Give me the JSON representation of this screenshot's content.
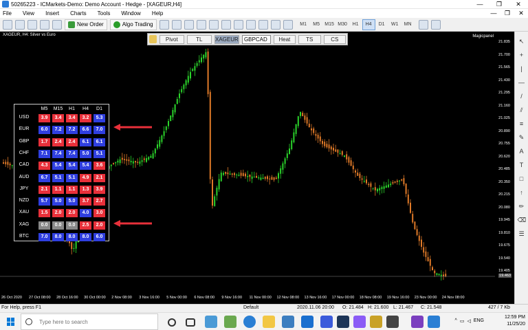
{
  "window": {
    "title": "50265223 - ICMarkets-Demo: Demo Account - Hedge - [XAGEUR,H4]",
    "controls": [
      "—",
      "❐",
      "✕"
    ]
  },
  "menu": {
    "items": [
      "File",
      "View",
      "Insert",
      "Charts",
      "Tools",
      "Window",
      "Help"
    ],
    "mdi_controls": [
      "—",
      "❐",
      "✕"
    ]
  },
  "toolbar": {
    "new_order_label": "New Order",
    "algo_trading_label": "Algo Trading",
    "timeframes": [
      "M1",
      "M5",
      "M15",
      "M30",
      "H1",
      "H4",
      "D1",
      "W1",
      "MN"
    ],
    "active_timeframe": "H4"
  },
  "chart": {
    "label": "XAGEUR, H4: Silver vs Euro",
    "panel_label": "Magicpanel",
    "buttons": [
      "Pivot",
      "TL",
      "XAGEUR",
      "Heat",
      "TS",
      "CS"
    ],
    "selected_button": "XAGEUR",
    "symbol_dropdown": "GBPCAD",
    "price_axis": [
      "21.835",
      "21.700",
      "21.565",
      "21.430",
      "21.295",
      "21.160",
      "21.025",
      "20.890",
      "20.755",
      "20.620",
      "20.485",
      "20.350",
      "20.215",
      "20.080",
      "19.945",
      "19.810",
      "19.675",
      "19.540",
      "19.405"
    ],
    "current_price": "19.463",
    "time_axis": [
      "26 Oct 2020",
      "27 Oct 08:00",
      "28 Oct 16:00",
      "30 Oct 00:00",
      "2 Nov 08:00",
      "3 Nov 16:00",
      "5 Nov 00:00",
      "6 Nov 08:00",
      "9 Nov 16:00",
      "11 Nov 00:00",
      "12 Nov 08:00",
      "13 Nov 16:00",
      "17 Nov 00:00",
      "18 Nov 08:00",
      "19 Nov 16:00",
      "23 Nov 00:00",
      "24 Nov 08:00"
    ]
  },
  "matrix": {
    "columns": [
      "M5",
      "M15",
      "H1",
      "H4",
      "D1"
    ],
    "rows": [
      {
        "label": "USD",
        "values": [
          "3.9",
          "3.4",
          "3.4",
          "3.2",
          "5.3"
        ],
        "colors": [
          "r",
          "r",
          "r",
          "r",
          "b"
        ]
      },
      {
        "label": "EUR",
        "values": [
          "6.0",
          "7.2",
          "7.2",
          "6.6",
          "7.0"
        ],
        "colors": [
          "b",
          "b",
          "b",
          "b",
          "b"
        ]
      },
      {
        "label": "GBP",
        "values": [
          "1.7",
          "2.4",
          "2.4",
          "6.1",
          "6.1"
        ],
        "colors": [
          "r",
          "r",
          "r",
          "b",
          "b"
        ]
      },
      {
        "label": "CHF",
        "values": [
          "7.1",
          "7.4",
          "7.4",
          "5.0",
          "5.1"
        ],
        "colors": [
          "b",
          "b",
          "b",
          "b",
          "b"
        ]
      },
      {
        "label": "CAD",
        "values": [
          "4.3",
          "5.4",
          "5.4",
          "5.4",
          "3.6"
        ],
        "colors": [
          "r",
          "b",
          "b",
          "b",
          "r"
        ]
      },
      {
        "label": "AUD",
        "values": [
          "6.7",
          "5.1",
          "5.1",
          "4.9",
          "2.1"
        ],
        "colors": [
          "b",
          "b",
          "b",
          "r",
          "r"
        ]
      },
      {
        "label": "JPY",
        "values": [
          "2.1",
          "1.1",
          "1.1",
          "1.3",
          "3.9"
        ],
        "colors": [
          "r",
          "r",
          "r",
          "r",
          "r"
        ]
      },
      {
        "label": "NZD",
        "values": [
          "5.7",
          "5.0",
          "5.0",
          "3.7",
          "2.7"
        ],
        "colors": [
          "b",
          "b",
          "b",
          "r",
          "r"
        ]
      },
      {
        "label": "XAU",
        "values": [
          "1.5",
          "2.0",
          "2.0",
          "4.0",
          "3.0"
        ],
        "colors": [
          "r",
          "r",
          "r",
          "b",
          "r"
        ]
      },
      {
        "label": "XAG",
        "values": [
          "0.0",
          "0.0",
          "0.0",
          "2.5",
          "2.0"
        ],
        "colors": [
          "g",
          "g",
          "g",
          "r",
          "r"
        ]
      },
      {
        "label": "BTC",
        "values": [
          "7.0",
          "8.0",
          "8.0",
          "8.0",
          "6.0"
        ],
        "colors": [
          "b",
          "b",
          "b",
          "b",
          "b"
        ]
      }
    ],
    "cell_colors": {
      "r": "#e8303a",
      "b": "#2f3fe0",
      "g": "#888888"
    }
  },
  "status": {
    "help_text": "For Help, press F1",
    "profile": "Default",
    "datetime": "2020.11.06 20:00",
    "open": "O: 21.484",
    "high": "H: 21.600",
    "low": "L: 21.467",
    "close": "C: 21.548",
    "traffic": "427 / 7 Kb"
  },
  "taskbar": {
    "search_placeholder": "Type here to search",
    "language": "ENG",
    "time": "12:59 PM",
    "date": "11/25/20"
  }
}
